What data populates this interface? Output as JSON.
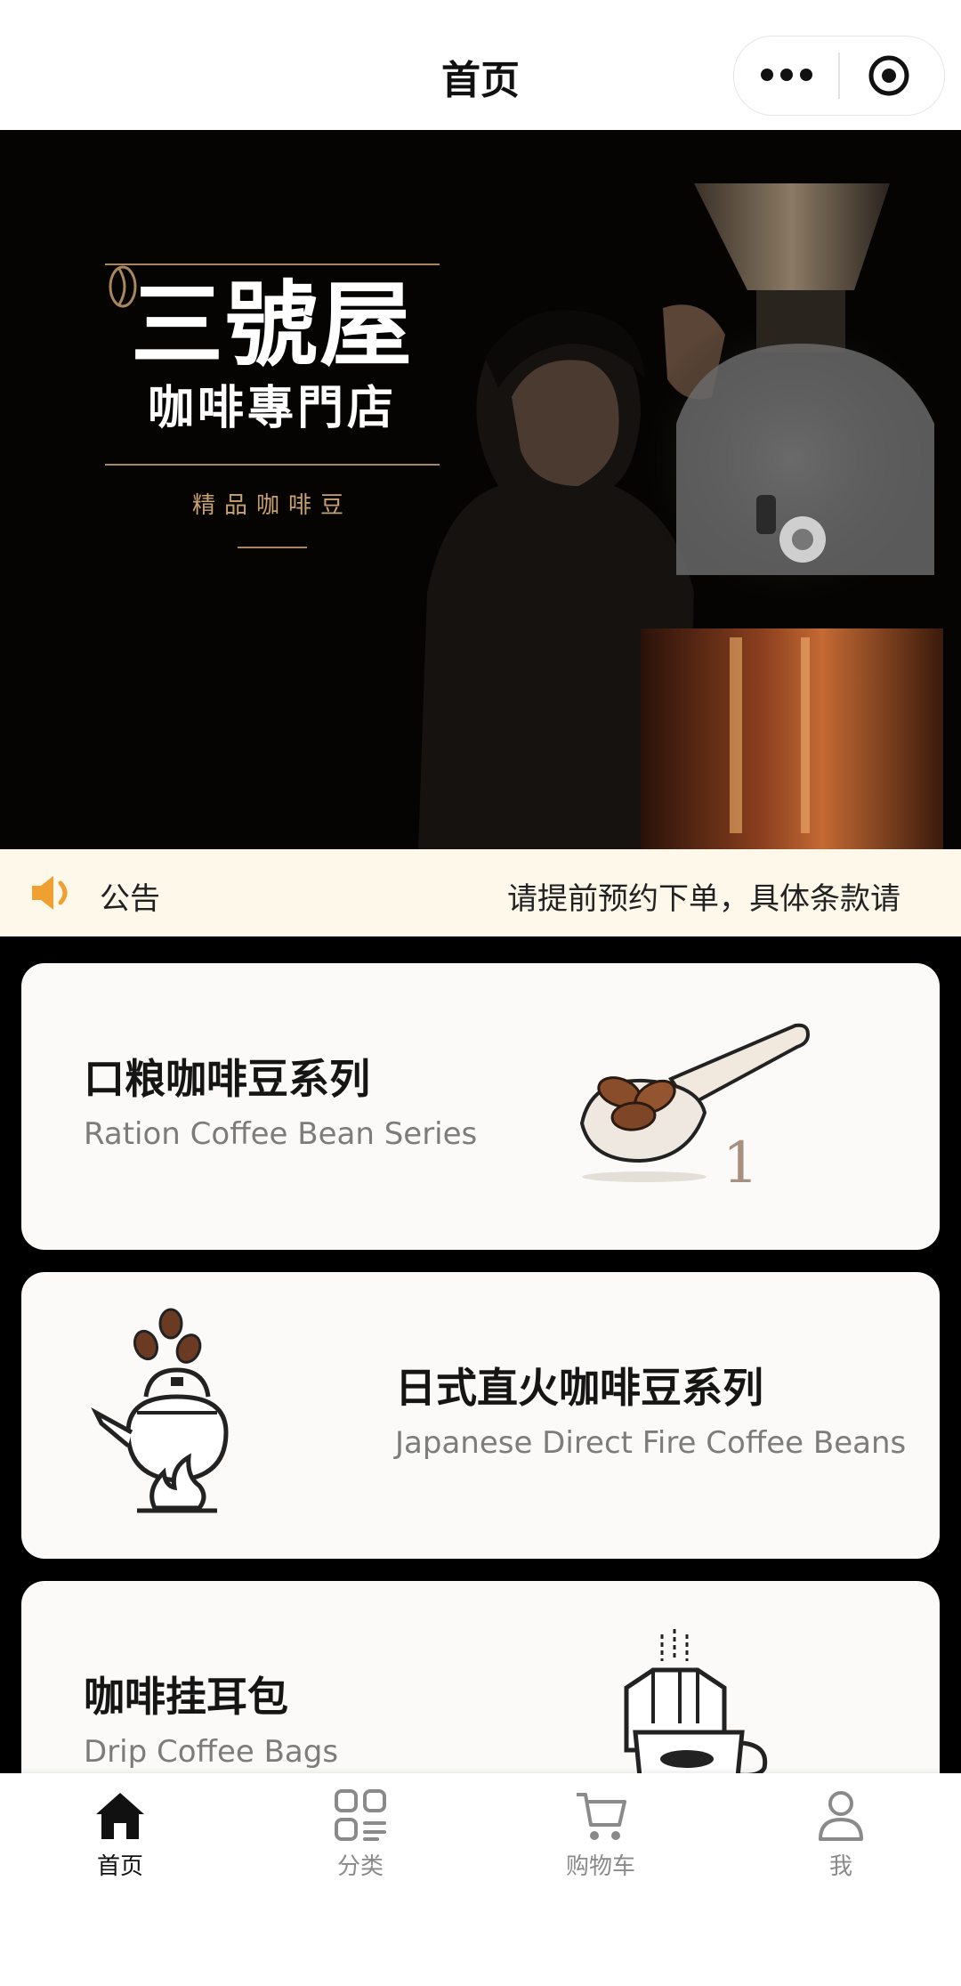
{
  "nav": {
    "title": "首页",
    "more_icon": "more-dots-icon",
    "close_icon": "target-circle-icon"
  },
  "hero": {
    "brand_name": "三號屋",
    "brand_sub": "咖啡專門店",
    "tagline": "精品咖啡豆",
    "accent": "#a8865e"
  },
  "notice": {
    "icon": "speaker-icon",
    "label": "公告",
    "text": "请提前预约下单，具体条款请",
    "icon_color": "#f0a030",
    "background": "#fdf8ea"
  },
  "categories": [
    {
      "title_zh": "口粮咖啡豆系列",
      "title_en": "Ration Coffee Bean Series",
      "icon": "coffee-scoop-icon"
    },
    {
      "title_zh": "日式直火咖啡豆系列",
      "title_en": "Japanese Direct Fire Coffee Beans",
      "icon": "kettle-fire-icon"
    },
    {
      "title_zh": "咖啡挂耳包",
      "title_en": "Drip Coffee Bags",
      "icon": "drip-bag-cup-icon"
    }
  ],
  "scoop_number": "1",
  "tabs": [
    {
      "label": "首页",
      "icon": "home-icon",
      "active": true
    },
    {
      "label": "分类",
      "icon": "category-icon",
      "active": false
    },
    {
      "label": "购物车",
      "icon": "cart-icon",
      "active": false
    },
    {
      "label": "我",
      "icon": "user-icon",
      "active": false
    }
  ]
}
